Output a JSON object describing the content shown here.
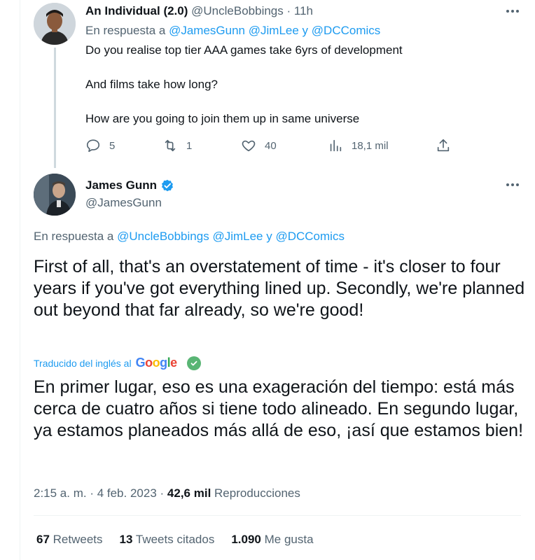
{
  "reply_tweet": {
    "display_name": "An Individual (2.0)",
    "handle": "@UncleBobbings",
    "separator": "·",
    "time": "11h",
    "replying_prefix": "En respuesta a",
    "replying_mentions": [
      "@JamesGunn",
      "@JimLee"
    ],
    "replying_conjunction": "y",
    "replying_last": "@DCComics",
    "body_lines": [
      "Do you realise top tier AAA games take 6yrs of development",
      "And films take how long?",
      "How are you going to join them up in same universe"
    ],
    "actions": {
      "replies": "5",
      "retweets": "1",
      "likes": "40",
      "views": "18,1 mil"
    }
  },
  "main_tweet": {
    "display_name": "James Gunn",
    "handle": "@JamesGunn",
    "verified": true,
    "replying_prefix": "En respuesta a",
    "replying_mentions": [
      "@UncleBobbings",
      "@JimLee"
    ],
    "replying_conjunction": "y",
    "replying_last": "@DCComics",
    "text": "First of all, that's an overstatement of time - it's closer to four years if you've got everything lined up. Secondly, we're planned out beyond that far already, so we're good!",
    "translated_label": "Traducido del inglés al",
    "translation_provider": "Google",
    "translation": "En primer lugar, eso es una exageración del tiempo: está más cerca de cuatro años si tiene todo alineado. En segundo lugar, ya estamos planeados más allá de eso, ¡así que estamos bien!",
    "timestamp": "2:15 a. m. · 4 feb. 2023",
    "separator": "·",
    "views_count": "42,6 mil",
    "views_label": "Reproducciones",
    "stats": {
      "retweets_count": "67",
      "retweets_label": "Retweets",
      "quotes_count": "13",
      "quotes_label": "Tweets citados",
      "likes_count": "1.090",
      "likes_label": "Me gusta"
    }
  },
  "colors": {
    "accent": "#1d9bf0",
    "text": "#0f1419",
    "secondary": "#536471",
    "verified": "#1d9bf0",
    "translation_check": "#59b574"
  },
  "icons": [
    "reply-icon",
    "retweet-icon",
    "like-icon",
    "views-icon",
    "share-icon",
    "more-icon",
    "verified-badge-icon",
    "check-icon"
  ]
}
